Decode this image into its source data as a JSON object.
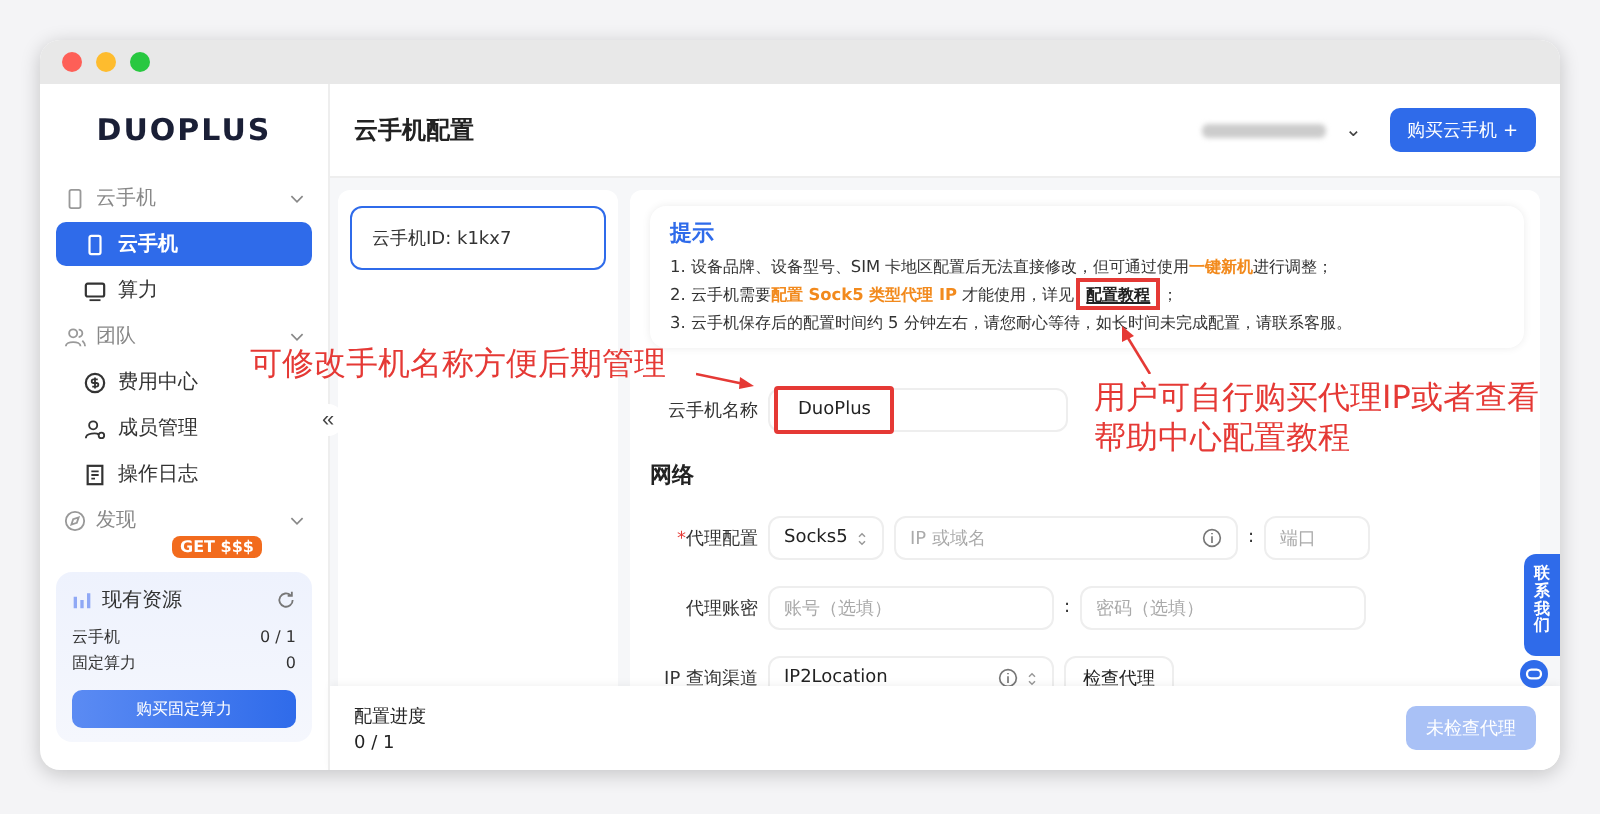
{
  "logo": "DUOPLUS",
  "header": {
    "title": "云手机配置",
    "account_chevron": "⌄",
    "buy_button": "购买云手机 +"
  },
  "sidebar": {
    "groups": [
      {
        "label": "云手机",
        "kind": "phone-group",
        "expanded": true,
        "children": [
          {
            "label": "云手机",
            "kind": "phone",
            "selected": true
          },
          {
            "label": "算力",
            "kind": "monitor",
            "selected": false
          }
        ]
      },
      {
        "label": "团队",
        "kind": "team",
        "expanded": true,
        "children": [
          {
            "label": "费用中心",
            "kind": "coin",
            "selected": false
          },
          {
            "label": "成员管理",
            "kind": "users",
            "selected": false
          },
          {
            "label": "操作日志",
            "kind": "log",
            "selected": false
          }
        ]
      },
      {
        "label": "发现",
        "kind": "discover",
        "expanded": true,
        "badge": "GET $$$"
      }
    ],
    "collapse_glyph": "«",
    "resources": {
      "title": "现有资源",
      "rows": [
        {
          "label": "云手机",
          "value": "0 / 1"
        },
        {
          "label": "固定算力",
          "value": "0"
        }
      ],
      "button": "购买固定算力"
    }
  },
  "device_card": {
    "id_text": "云手机ID: k1kx7",
    "selected": true
  },
  "tips": {
    "title": "提示",
    "lines": [
      [
        {
          "kind": "plain",
          "text": "1. 设备品牌、设备型号、SIM 卡地区配置后无法直接修改，但可通过使用"
        },
        {
          "kind": "highlight",
          "text": "一键新机"
        },
        {
          "kind": "plain",
          "text": "进行调整；"
        }
      ],
      [
        {
          "kind": "plain",
          "text": "2. 云手机需要"
        },
        {
          "kind": "highlight",
          "text": "配置 Sock5 类型代理 IP"
        },
        {
          "kind": "plain",
          "text": " 才能使用，详见"
        },
        {
          "kind": "link",
          "text": "配置教程"
        },
        {
          "kind": "plain",
          "text": "；"
        }
      ],
      [
        {
          "kind": "plain",
          "text": "3. 云手机保存后的配置时间约 5 分钟左右，请您耐心等待，如长时间未完成配置，请联系客服。"
        }
      ]
    ]
  },
  "form": {
    "required_mark": "*",
    "name_label": "云手机名称",
    "name_value": "DuoPlus",
    "section": "网络",
    "rows": [
      {
        "label": "代理配置",
        "required": true,
        "fields": [
          {
            "kind": "select",
            "value": "Socks5",
            "info": false
          },
          {
            "kind": "input",
            "placeholder": "IP 或域名",
            "info": true
          },
          {
            "kind": "sep",
            "text": ":"
          },
          {
            "kind": "input",
            "placeholder": "端口",
            "info": false
          }
        ]
      },
      {
        "label": "代理账密",
        "required": false,
        "fields": [
          {
            "kind": "input",
            "placeholder": "账号（选填）",
            "info": false
          },
          {
            "kind": "sep",
            "text": ":"
          },
          {
            "kind": "input",
            "placeholder": "密码（选填）",
            "info": false
          }
        ]
      },
      {
        "label": "IP 查询渠道",
        "required": false,
        "fields": [
          {
            "kind": "select",
            "value": "IP2Location",
            "info": true
          },
          {
            "kind": "button",
            "text": "检查代理"
          }
        ]
      }
    ]
  },
  "footer": {
    "label": "配置进度",
    "value": "0 / 1",
    "button": "未检查代理",
    "disabled": true
  },
  "contact": {
    "label": "联系我们"
  },
  "annotations": [
    {
      "kind": "name-note",
      "text": "可修改手机名称方便后期管理"
    },
    {
      "kind": "tutorial-note",
      "text": "用户可自行购买代理IP或者查看帮助中心配置教程"
    }
  ]
}
